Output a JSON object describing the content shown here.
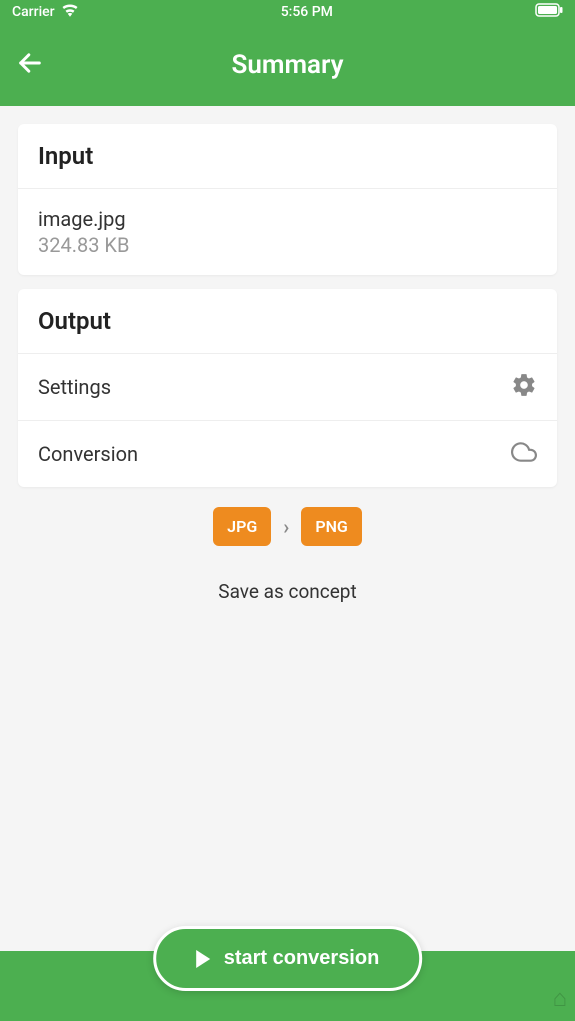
{
  "statusBar": {
    "carrier": "Carrier",
    "time": "5:56 PM"
  },
  "header": {
    "title": "Summary"
  },
  "input": {
    "sectionTitle": "Input",
    "filename": "image.jpg",
    "filesize": "324.83 KB"
  },
  "output": {
    "sectionTitle": "Output",
    "settingsLabel": "Settings",
    "conversionLabel": "Conversion"
  },
  "conversion": {
    "from": "JPG",
    "to": "PNG"
  },
  "actions": {
    "saveConcept": "Save as concept",
    "startConversion": "start conversion"
  }
}
